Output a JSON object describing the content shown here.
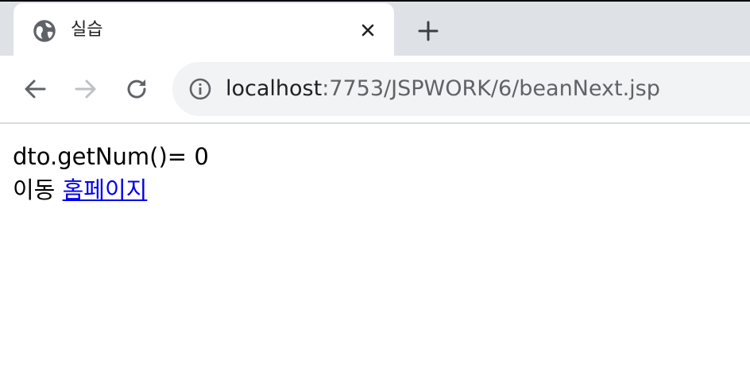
{
  "tab": {
    "title": "실습",
    "favicon": "globe-icon",
    "close_icon": "close-icon"
  },
  "new_tab_icon": "plus-icon",
  "toolbar": {
    "back_icon": "arrow-left-icon",
    "forward_icon": "arrow-right-icon",
    "reload_icon": "reload-icon",
    "info_icon": "info-icon",
    "url_host": "localhost",
    "url_path": ":7753/JSPWORK/6/beanNext.jsp"
  },
  "page": {
    "line1": "dto.getNum()= 0",
    "line2_prefix": "이동",
    "link_text": "홈페이지"
  },
  "colors": {
    "tabstrip": "#dee1e6",
    "omnibox": "#f1f3f4",
    "link": "#0000ee"
  }
}
